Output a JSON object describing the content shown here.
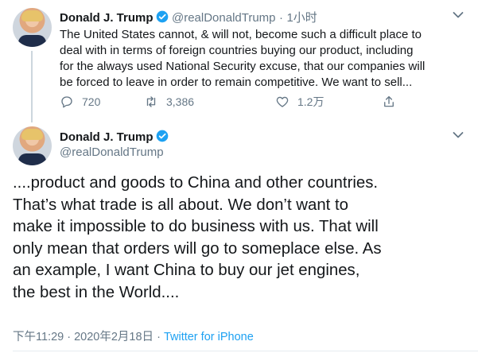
{
  "tweet1": {
    "name": "Donald J. Trump",
    "handle": "@realDonaldTrump",
    "separator": "·",
    "time": "1小时",
    "lines": [
      "The United States cannot, & will not, become such a difficult place to",
      "deal with in terms of foreign countries buying our product, including",
      "for the always used National Security excuse, that our companies will",
      "be forced to leave in order to remain competitive. We want to sell..."
    ],
    "reply_icon": "reply-icon",
    "retweet_icon": "retweet-icon",
    "like_icon": "heart-icon",
    "share_icon": "share-icon",
    "replies": "720",
    "retweets": "3,386",
    "likes": "1.2万"
  },
  "tweet2": {
    "name": "Donald J. Trump",
    "handle": "@realDonaldTrump",
    "lines": [
      "....product and goods to China and other countries.",
      "That’s what trade is all about. We don’t want to",
      "make it impossible to do business with us. That will",
      "only mean that orders will go to someplace else. As",
      "an example, I want China to buy our jet engines,",
      "the best in the World...."
    ],
    "timestamp": "下午11:29 · 2020年2月18日 · ",
    "source": "Twitter for iPhone"
  },
  "colors": {
    "accent": "#1da1f2",
    "secondary_text": "#657786",
    "primary_text": "#14171a"
  }
}
